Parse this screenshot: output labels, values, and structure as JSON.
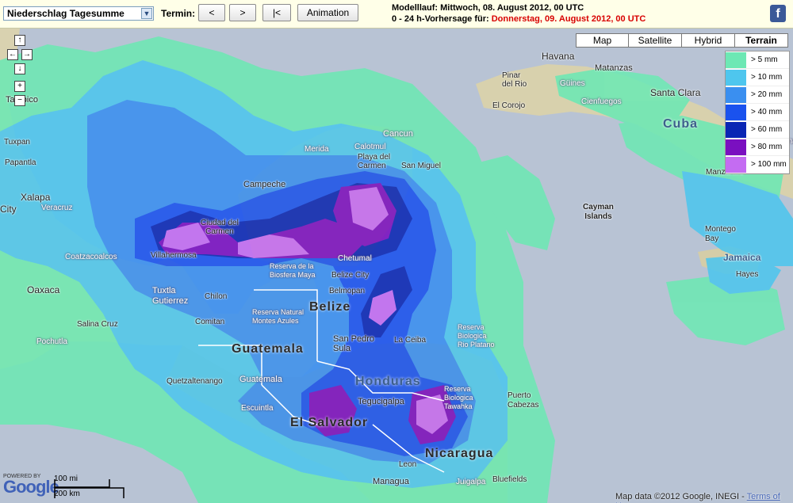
{
  "toolbar": {
    "product_select": "Niederschlag Tagesumme",
    "termin_label": "Termin:",
    "prev_label": "<",
    "next_label": ">",
    "first_label": "|<",
    "animation_label": "Animation"
  },
  "header": {
    "run_label": "Modelllauf:",
    "run_value": "Mittwoch, 08. August 2012, 00 UTC",
    "forecast_label": "0 - 24 h-Vorhersage für:",
    "forecast_date": "Donnerstag, 09. August 2012, 00 UTC",
    "social_icon": "facebook-icon",
    "social_glyph": "f"
  },
  "map": {
    "nav_glyphs": {
      "up": "↑",
      "left": "←",
      "right": "→",
      "down": "↓",
      "zoom_in": "+",
      "zoom_out": "−"
    },
    "map_types": [
      {
        "label": "Map",
        "active": false
      },
      {
        "label": "Satellite",
        "active": false
      },
      {
        "label": "Hybrid",
        "active": false
      },
      {
        "label": "Terrain",
        "active": true
      }
    ],
    "legend": [
      {
        "label": "> 5 mm",
        "color": "#6de8b4"
      },
      {
        "label": "> 10 mm",
        "color": "#4ec6ee"
      },
      {
        "label": "> 20 mm",
        "color": "#3a8ff0"
      },
      {
        "label": "> 40 mm",
        "color": "#1a52ee"
      },
      {
        "label": "> 60 mm",
        "color": "#0a26b4"
      },
      {
        "label": "> 80 mm",
        "color": "#7a0fc0"
      },
      {
        "label": "> 100 mm",
        "color": "#c46cf2"
      }
    ],
    "places": {
      "havana": "Havana",
      "matanzas": "Matanzas",
      "pinar": "Pinar\ndel Rio",
      "guines": "Güines",
      "cienfuegos": "Cienfuegos",
      "santa_clara": "Santa Clara",
      "el_corojo": "El Corojo",
      "cuba": "Cuba",
      "camaguey": "Cama",
      "manzanillo": "Manzanillo",
      "cayman": "Cayman\nIslands",
      "montego": "Montego\nBay",
      "jamaica": "Jamaica",
      "hayes": "Hayes",
      "tampico": "Tampico",
      "tuxpan": "Tuxpan",
      "papantla": "Papantla",
      "xalapa": "Xalapa",
      "city": "City",
      "veracruz": "Veracruz",
      "coatzacoalcos": "Coatzacoalcos",
      "oaxaca": "Oaxaca",
      "salina_cruz": "Salina Cruz",
      "pochutla": "Pochutla",
      "merida": "Merida",
      "calotmul": "Calotmul",
      "cancun": "Cancun",
      "playa": "Playa del\nCarmen",
      "san_miguel": "San Miguel",
      "campeche": "Campeche",
      "ciudad_carmen": "Ciudad del\nCarmen",
      "villahermosa": "Villahermosa",
      "chetumal": "Chetumal",
      "tuxtla": "Tuxtla\nGutierrez",
      "chilon": "Chilon",
      "comitan": "Comitan",
      "reserva_maya": "Reserva de la\nBiosfera Maya",
      "belize_city": "Belize City",
      "belmopan": "Belmopan",
      "belize": "Belize",
      "reserva_azules": "Reserva Natural\nMontes Azules",
      "guatemala": "Guatemala",
      "guatemala_city": "Guatemala",
      "san_pedro": "San Pedro\nSula",
      "la_ceiba": "La Ceiba",
      "reserva_platano": "Reserva\nBiologica\nRio Platano",
      "honduras": "Honduras",
      "quetzaltenango": "Quetzaltenango",
      "escuintla": "Escuintla",
      "tegucigalpa": "Tegucigalpa",
      "reserva_tawahka": "Reserva\nBiologica\nTawahka",
      "el_salvador": "El Salvador",
      "puerto_cabezas": "Puerto\nCabezas",
      "nicaragua": "Nicaragua",
      "leon": "Leon",
      "managua": "Managua",
      "juigalpa": "Juigalpa",
      "bluefields": "Bluefields"
    },
    "scale_mi": "100 mi",
    "scale_km": "200 km",
    "powered_by": "POWERED BY",
    "google": "Google",
    "attribution": "Map data ©2012 Google, INEGI - ",
    "terms": "Terms of Use"
  }
}
